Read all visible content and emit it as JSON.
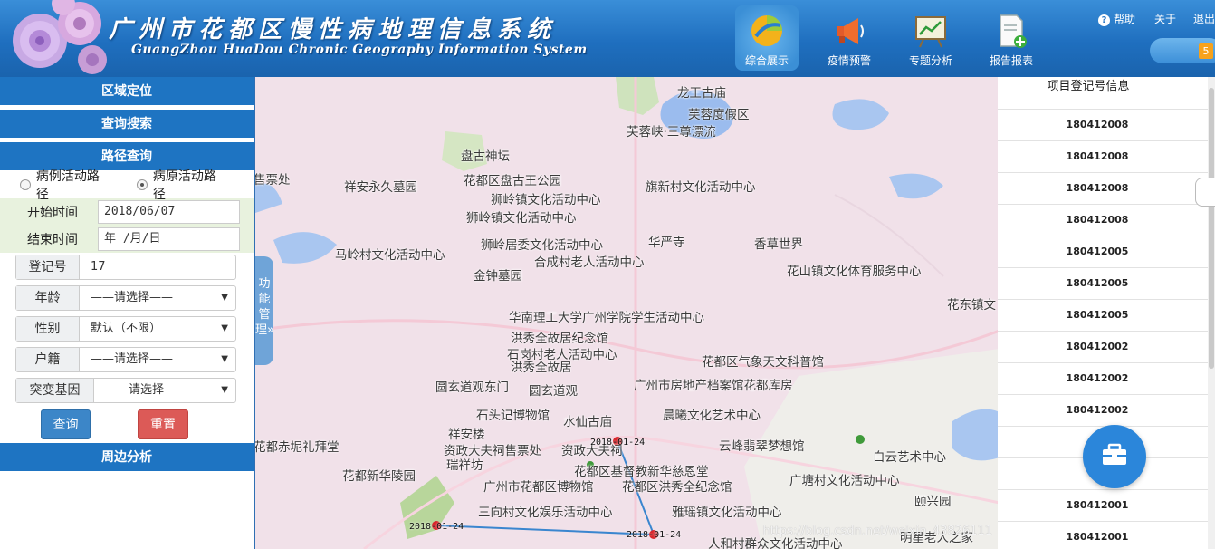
{
  "header": {
    "title": "广州市花都区慢性病地理信息系统",
    "subtitle": "GuangZhou HuaDou Chronic Geography Information System",
    "nav": [
      {
        "label": "综合展示",
        "icon": "pie-chart-icon",
        "active": true
      },
      {
        "label": "疫情预警",
        "icon": "megaphone-icon",
        "active": false
      },
      {
        "label": "专题分析",
        "icon": "line-chart-board-icon",
        "active": false
      },
      {
        "label": "报告报表",
        "icon": "report-add-icon",
        "active": false
      }
    ],
    "links": {
      "help": "帮助",
      "about": "关于",
      "exit": "退出"
    },
    "message_count": "5"
  },
  "left": {
    "sections": {
      "region": "区域定位",
      "search": "查询搜索",
      "route": "路径查询",
      "nearby": "周边分析"
    },
    "route_type": {
      "options": [
        "病例活动路径",
        "病原活动路径"
      ],
      "selected": "病原活动路径"
    },
    "start_date": {
      "label": "开始时间",
      "value": "2018/06/07"
    },
    "end_date": {
      "label": "结束时间",
      "value": "年 /月/日"
    },
    "filters": [
      {
        "label": "登记号",
        "value": "17",
        "type": "input"
      },
      {
        "label": "年龄",
        "value": "——请选择——",
        "type": "select"
      },
      {
        "label": "性别",
        "value": "默认（不限）",
        "type": "select"
      },
      {
        "label": "户籍",
        "value": "——请选择——",
        "type": "select"
      },
      {
        "label": "突变基因",
        "value": "——请选择——",
        "type": "select"
      }
    ],
    "buttons": {
      "query": "查询",
      "reset": "重置"
    }
  },
  "map": {
    "function_tab": "功能管理»",
    "watermark": "https://blog.csdn.net/weixin_43826111",
    "pois": [
      "龙王古庙",
      "芙蓉度假区",
      "芙蓉峡·三尊漂流",
      "盘古神坛",
      "售票处",
      "祥安永久墓园",
      "花都区盘古王公园",
      "狮岭镇文化活动中心",
      "旗新村文化活动中心",
      "狮岭镇文化活动中心",
      "马岭村文化活动中心",
      "狮岭居委文化活动中心",
      "华严寺",
      "香草世界",
      "合成村老人活动中心",
      "金钟墓园",
      "花山镇文化体育服务中心",
      "花东镇文",
      "华南理工大学广州学院学生活动中心",
      "洪秀全故居纪念馆",
      "石岗村老人活动中心",
      "洪秀全故居",
      "花都区气象天文科普馆",
      "圆玄道观东门",
      "圆玄道观",
      "广州市房地产档案馆花都库房",
      "石头记博物馆",
      "水仙古庙",
      "晨曦文化艺术中心",
      "祥安楼",
      "花都赤坭礼拜堂",
      "资政大夫祠售票处",
      "资政大夫祠",
      "云峰翡翠梦想馆",
      "瑞祥坊",
      "白云艺术中心",
      "花都区基督教新华慈恩堂",
      "花都新华陵园",
      "广州市花都区博物馆",
      "花都区洪秀全纪念馆",
      "广塘村文化活动中心",
      "颐兴园",
      "三向村文化娱乐活动中心",
      "雅瑶镇文化活动中心",
      "明星老人之家",
      "人和村群众文化活动中心"
    ],
    "track_points": [
      {
        "date": "2018-01-24"
      },
      {
        "date": "2018-01-24"
      },
      {
        "date": "2018-01-24"
      }
    ]
  },
  "right": {
    "title": "项目登记号信息",
    "rows": [
      "180412008",
      "180412008",
      "180412008",
      "180412008",
      "180412005",
      "180412005",
      "180412005",
      "180412002",
      "180412002",
      "180412002",
      "18",
      "18",
      "180412001",
      "180412001"
    ]
  },
  "colors": {
    "header_blue": "#1f6fbf",
    "section_blue": "#1e74c2",
    "map_pink": "#f1e1e9",
    "track_line": "#3a86cf",
    "track_point": "#d9262c",
    "query_button": "#3c86c8",
    "reset_button": "#dc5a57"
  }
}
